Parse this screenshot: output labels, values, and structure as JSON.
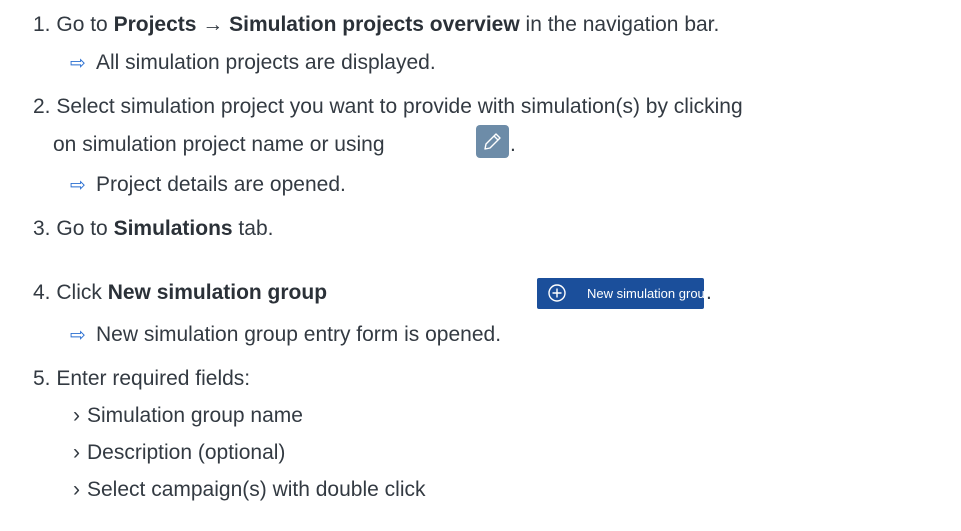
{
  "steps": [
    {
      "num": "1.",
      "pre": "Go to ",
      "b1": "Projects",
      "mid": " → ",
      "b2": "Simulation projects overview",
      "post": " in the navigation bar.",
      "result": "All simulation projects are displayed."
    },
    {
      "num": "2.",
      "line1": "Select simulation project you want to provide with simulation(s) by clicking",
      "line2": "on simulation project name or using",
      "after": ".",
      "result": "Project details are opened."
    },
    {
      "num": "3.",
      "pre": "Go to ",
      "bold": "Simulations",
      "post": " tab."
    },
    {
      "num": "4.",
      "pre": "Click ",
      "bold": "New simulation group",
      "after": ".",
      "button_label": "New simulation group",
      "result": "New simulation group entry form is opened."
    },
    {
      "num": "5.",
      "text": "Enter required fields:",
      "items": [
        "Simulation group name",
        "Description (optional)",
        "Select campaign(s) with double click"
      ]
    }
  ],
  "symbols": {
    "result_arrow": "⇨",
    "bullet": "›"
  },
  "icons": {
    "edit": "pencil-icon",
    "add": "plus-circle-icon"
  },
  "colors": {
    "text": "#333a42",
    "arrow": "#2a6fd1",
    "primary_button": "#1b4f9b",
    "edit_button": "#6d8ca8"
  }
}
